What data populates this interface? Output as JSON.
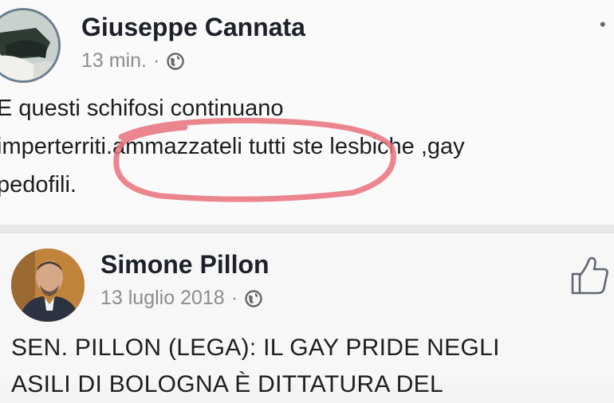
{
  "post1": {
    "author": "Giuseppe Cannata",
    "time": "13 min.",
    "separator": "·",
    "privacy_icon": "globe-icon",
    "menu_icon": "more-options-icon",
    "lines": [
      "E questi schifosi continuano",
      "imperterriti.ammazzateli tutti ste lesbiche ,gay",
      "pedofili."
    ],
    "highlight_color": "#e8707a"
  },
  "post2": {
    "author": "Simone Pillon",
    "time": "13 luglio 2018",
    "separator": "·",
    "privacy_icon": "globe-icon",
    "action_icon": "like-thumb-icon",
    "lines": [
      "SEN. PILLON (LEGA): IL GAY PRIDE NEGLI",
      "ASILI DI BOLOGNA È DITTATURA DEL"
    ]
  },
  "colors": {
    "name": "#1d2129",
    "meta": "#8a8d91",
    "text": "#1c1e21",
    "background": "#fafafb"
  }
}
